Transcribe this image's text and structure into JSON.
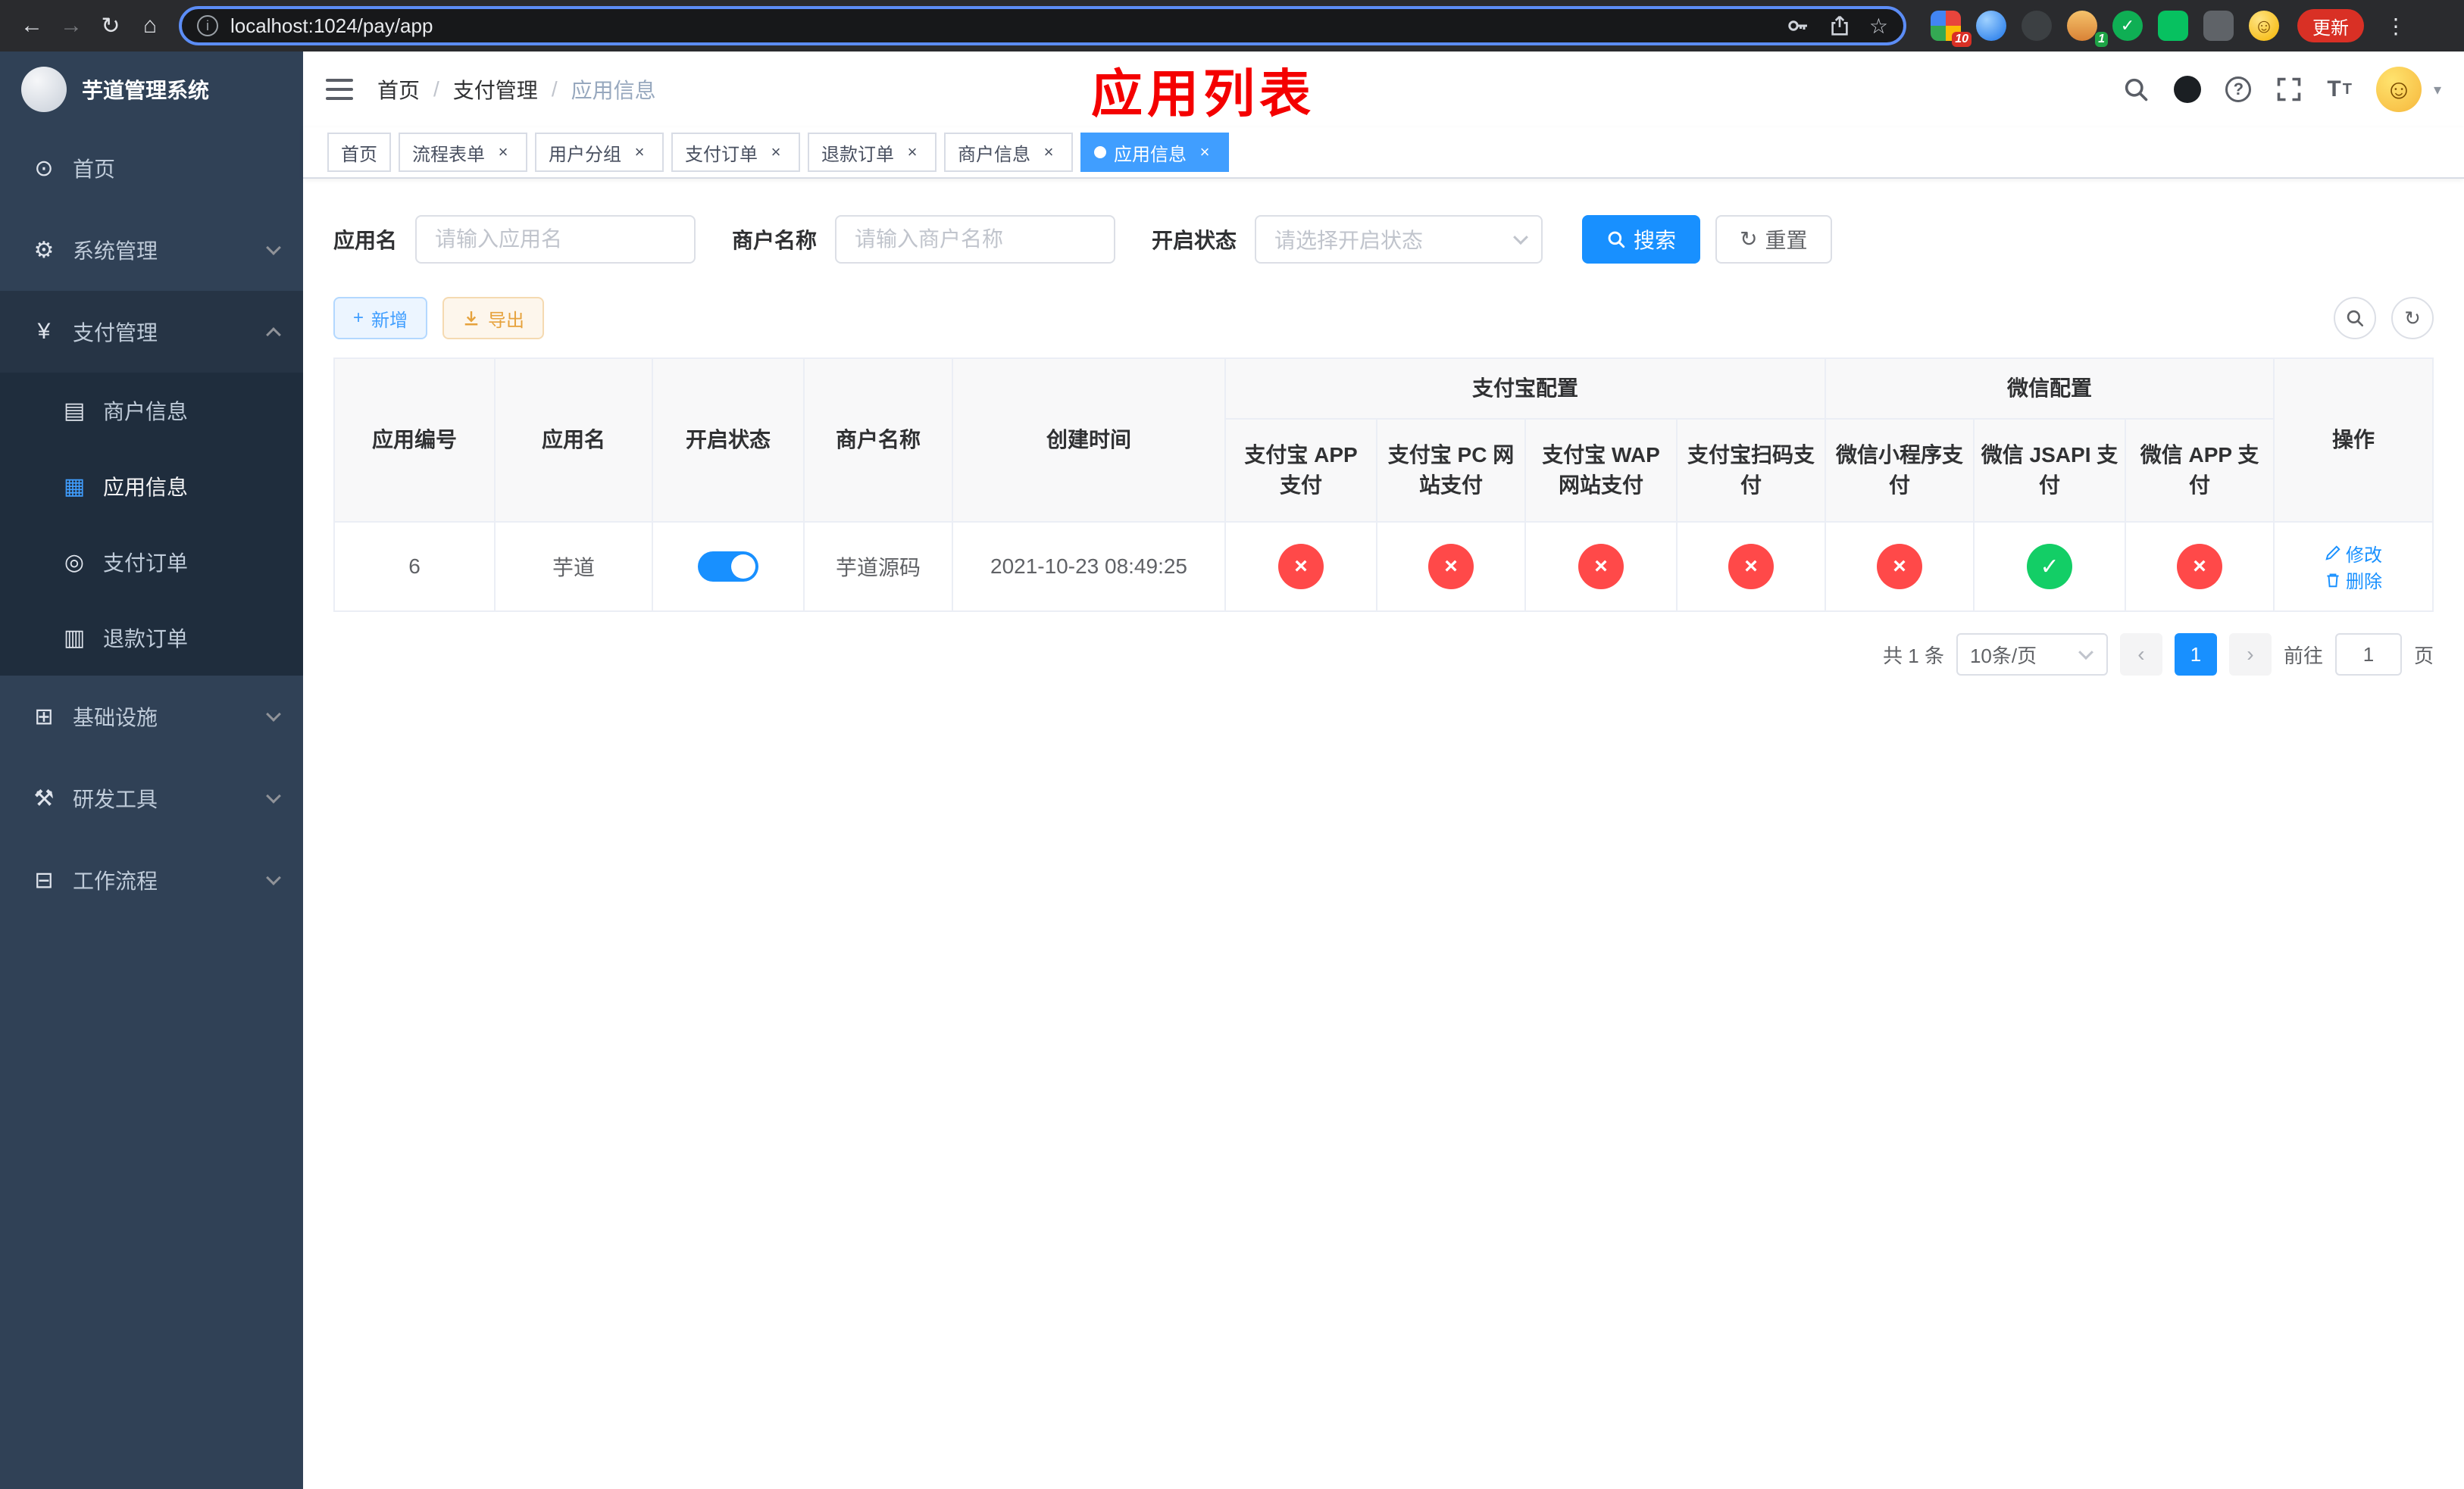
{
  "browser": {
    "url": "localhost:1024/pay/app",
    "update_label": "更新",
    "ext_badge_grid": "10",
    "ext_badge_avatar": "1"
  },
  "icons": {
    "back": "←",
    "forward": "→",
    "reload": "↻",
    "home": "⌂",
    "info": "i",
    "star": "☆",
    "menu_dots": "⋮",
    "slash": "/",
    "question": "?",
    "letter_t": "T",
    "smiley": "☺",
    "caret": "▾",
    "close": "×",
    "check": "✓",
    "cross": "×",
    "plus": "+",
    "prev": "‹",
    "next": "›"
  },
  "sidebar": {
    "logo_title": "芋道管理系统",
    "menu": [
      {
        "label": "首页",
        "icon": "⊙"
      },
      {
        "label": "系统管理",
        "icon": "⚙"
      },
      {
        "label": "支付管理",
        "icon": "¥"
      },
      {
        "label": "商户信息",
        "icon": "▤"
      },
      {
        "label": "应用信息",
        "icon": "▦"
      },
      {
        "label": "支付订单",
        "icon": "◎"
      },
      {
        "label": "退款订单",
        "icon": "▥"
      },
      {
        "label": "基础设施",
        "icon": "⊞"
      },
      {
        "label": "研发工具",
        "icon": "⚒"
      },
      {
        "label": "工作流程",
        "icon": "⊟"
      }
    ]
  },
  "navbar": {
    "breadcrumb": [
      "首页",
      "支付管理",
      "应用信息"
    ],
    "annotation": "应用列表"
  },
  "tabs": [
    {
      "label": "首页"
    },
    {
      "label": "流程表单"
    },
    {
      "label": "用户分组"
    },
    {
      "label": "支付订单"
    },
    {
      "label": "退款订单"
    },
    {
      "label": "商户信息"
    },
    {
      "label": "应用信息"
    }
  ],
  "filters": {
    "app_name_label": "应用名",
    "app_name_placeholder": "请输入应用名",
    "merchant_label": "商户名称",
    "merchant_placeholder": "请输入商户名称",
    "status_label": "开启状态",
    "status_placeholder": "请选择开启状态",
    "search_label": "搜索",
    "reset_label": "重置"
  },
  "toolbar": {
    "add_label": "新增",
    "export_label": "导出"
  },
  "table": {
    "header": {
      "app_id": "应用编号",
      "app_name": "应用名",
      "status": "开启状态",
      "merchant": "商户名称",
      "created": "创建时间",
      "alipay_group": "支付宝配置",
      "alipay_app": "支付宝 APP 支付",
      "alipay_pc": "支付宝 PC 网站支付",
      "alipay_wap": "支付宝 WAP 网站支付",
      "alipay_scan": "支付宝扫码支付",
      "wechat_group": "微信配置",
      "wechat_mini": "微信小程序支付",
      "wechat_jsapi": "微信 JSAPI 支付",
      "wechat_app": "微信 APP 支付",
      "actions": "操作"
    },
    "rows": [
      {
        "app_id": "6",
        "app_name": "芋道",
        "status_on": true,
        "merchant": "芋道源码",
        "created": "2021-10-23 08:49:25",
        "channels": [
          "no",
          "no",
          "no",
          "no",
          "no",
          "yes",
          "no"
        ],
        "edit_label": "修改",
        "delete_label": "删除"
      }
    ]
  },
  "pagination": {
    "total": "共 1 条",
    "page_size": "10条/页",
    "page": "1",
    "goto_label": "前往",
    "goto_value": "1",
    "page_unit": "页"
  },
  "colors": {
    "primary": "#1890ff",
    "menu_active": "#409eff",
    "enabled": "#13ce66",
    "disabled": "#ff4949",
    "annotation": "#f40000"
  }
}
